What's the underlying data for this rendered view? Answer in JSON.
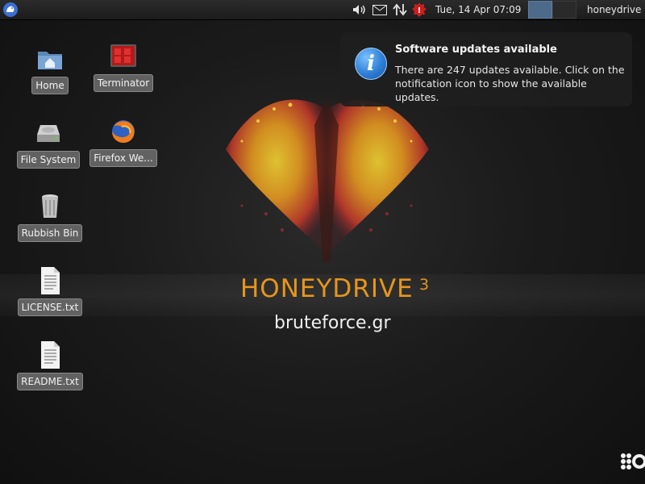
{
  "panel": {
    "clock": "Tue, 14 Apr  07:09",
    "username": "honeydrive",
    "tray_icons": [
      "volume-icon",
      "mail-icon",
      "network-icon",
      "update-notifier-icon"
    ],
    "update_badge": "!"
  },
  "desktop": {
    "icons": [
      {
        "label": "Home",
        "icon": "home-folder-icon"
      },
      {
        "label": "Terminator",
        "icon": "terminal-icon"
      },
      {
        "label": "File System",
        "icon": "drive-icon"
      },
      {
        "label": "Firefox We...",
        "icon": "firefox-icon"
      },
      {
        "label": "Rubbish Bin",
        "icon": "trash-icon"
      },
      {
        "label": "LICENSE.txt",
        "icon": "text-file-icon"
      },
      {
        "label": "README.txt",
        "icon": "text-file-icon"
      }
    ]
  },
  "notification": {
    "title": "Software updates available",
    "body": "There are 247 updates available. Click on the notification icon to show the available updates.",
    "icon": "info-icon",
    "icon_glyph": "i"
  },
  "wallpaper": {
    "brand": "HONEYDRIVE",
    "brand_version": "3",
    "site": "bruteforce.gr"
  },
  "colors": {
    "accent": "#e6961c",
    "workspace_active": "#4e6a8a",
    "info_blue": "#2f7fd6"
  }
}
